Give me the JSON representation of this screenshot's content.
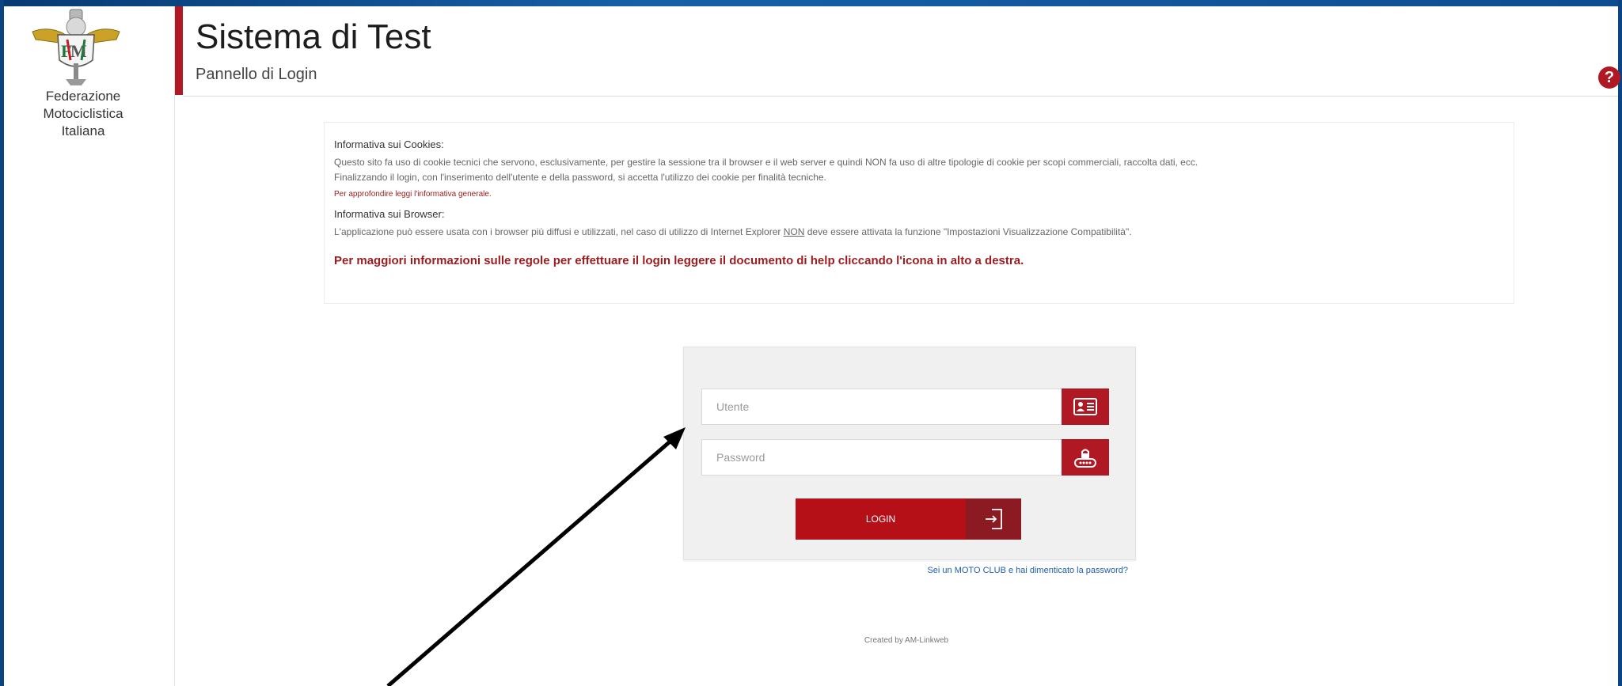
{
  "sidebar": {
    "org_name_lines": [
      "Federazione",
      "Motociclistica",
      "Italiana"
    ],
    "logo_icon": "fmi-logo"
  },
  "header": {
    "title": "Sistema di Test",
    "subtitle": "Pannello di Login",
    "help_icon": "help-icon",
    "help_glyph": "?"
  },
  "info": {
    "cookies_heading": "Informativa sui Cookies:",
    "cookies_text_1": "Questo sito fa uso di cookie tecnici che servono, esclusivamente, per gestire la sessione tra il browser e il web server e quindi NON fa uso di altre tipologie di cookie per scopi commerciali, raccolta dati, ecc.",
    "cookies_text_2": "Finalizzando il login, con l'inserimento dell'utente e della password, si accetta l'utilizzo dei cookie per finalità tecniche.",
    "cookies_more": "Per approfondire leggi l'informativa generale.",
    "browser_heading": "Informativa sui Browser:",
    "browser_text_prefix": "L'applicazione può essere usata con i browser più diffusi e utilizzati, nel caso di utilizzo di Internet Explorer ",
    "browser_text_emph": "NON",
    "browser_text_suffix": " deve essere attivata la funzione \"Impostazioni Visualizzazione Compatibilità\".",
    "help_notice": "Per maggiori informazioni sulle regole per effettuare il login leggere il documento di help cliccando l'icona in alto a destra."
  },
  "login": {
    "user_placeholder": "Utente",
    "password_placeholder": "Password",
    "user_icon": "id-card-icon",
    "password_icon": "lock-keypad-icon",
    "button_label": "LOGIN",
    "button_icon": "sign-in-icon",
    "forgot_link": "Sei un MOTO CLUB e hai dimenticato la password?"
  },
  "footer": {
    "created_by": "Created by AM-Linkweb"
  },
  "colors": {
    "accent": "#b01923",
    "frame": "#0d4d8f",
    "link": "#1f5ea8"
  }
}
